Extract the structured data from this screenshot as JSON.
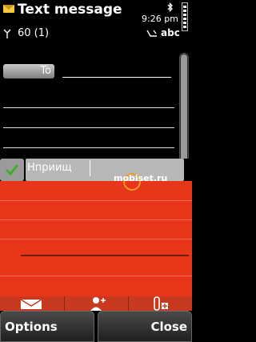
{
  "status_bar": {
    "title": "Text message",
    "time": "9:26 pm",
    "char_counter": "60 (1)",
    "input_mode": "abc",
    "icons": [
      "envelope-icon",
      "bluetooth-icon",
      "battery-icon",
      "antenna-icon",
      "handwriting-mode-icon"
    ]
  },
  "editor": {
    "to_label": "To",
    "recipient": "",
    "message_lines": 3
  },
  "prediction": {
    "current_word": "Нприищ"
  },
  "watermark": {
    "text": "mobiset.ru"
  },
  "toolbar": {
    "icons": [
      "message-icon",
      "add-recipient-icon",
      "attach-icon"
    ]
  },
  "softkeys": {
    "left": "Options",
    "right": "Close"
  },
  "colors": {
    "input_pane": "#e8361a",
    "toolbar": "#c73a20",
    "prediction_field": "#b8b8b8",
    "accent_yellow": "#f4c93a"
  }
}
